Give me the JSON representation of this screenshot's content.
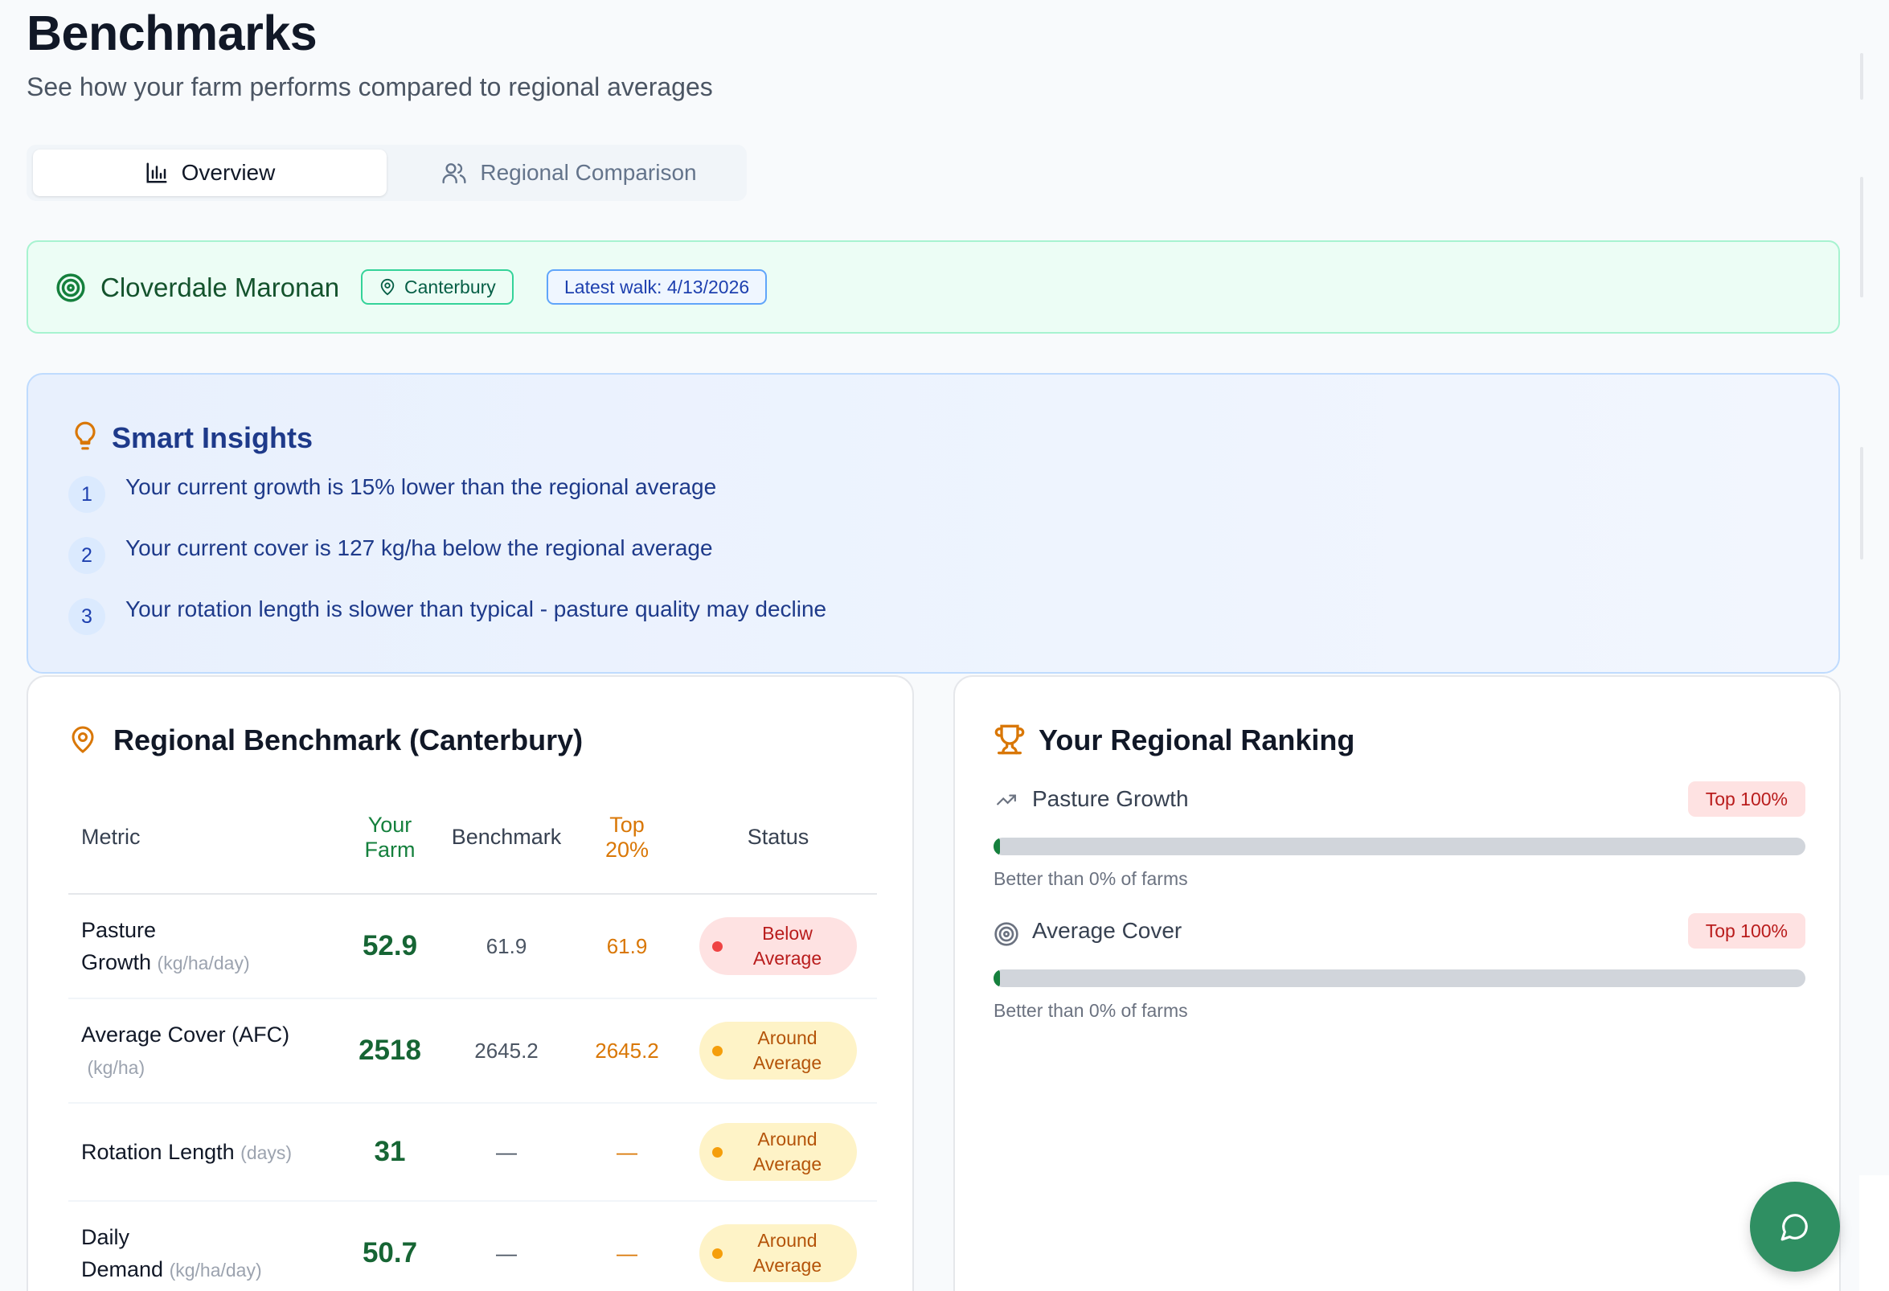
{
  "header": {
    "title": "Benchmarks",
    "subtitle": "See how your farm performs compared to regional averages"
  },
  "tabs": [
    {
      "label": "Overview",
      "icon": "bar-chart-icon",
      "active": true
    },
    {
      "label": "Regional Comparison",
      "icon": "users-icon",
      "active": false
    }
  ],
  "farm": {
    "name": "Cloverdale Maronan",
    "region": "Canterbury",
    "latest_walk": "Latest walk: 4/13/2026"
  },
  "insights": {
    "title": "Smart Insights",
    "items": [
      {
        "num": "1",
        "text": "Your current growth is 15% lower than the regional average"
      },
      {
        "num": "2",
        "text": "Your current cover is 127 kg/ha below the regional average"
      },
      {
        "num": "3",
        "text": "Your rotation length is slower than typical - pasture quality may decline"
      }
    ]
  },
  "benchmark": {
    "title": "Regional Benchmark (Canterbury)",
    "columns": {
      "metric": "Metric",
      "farm_line1": "Your",
      "farm_line2": "Farm",
      "benchmark": "Benchmark",
      "top_line1": "Top",
      "top_line2": "20%",
      "status": "Status"
    },
    "rows": [
      {
        "metric_line1": "Pasture",
        "metric_line2": "Growth",
        "unit": "(kg/ha/day)",
        "farm": "52.9",
        "benchmark": "61.9",
        "top": "61.9",
        "status_line1": "Below",
        "status_line2": "Average",
        "status_type": "below"
      },
      {
        "metric_line1": "Average Cover (AFC)",
        "metric_line2": "",
        "unit": "(kg/ha)",
        "farm": "2518",
        "benchmark": "2645.2",
        "top": "2645.2",
        "status_line1": "Around",
        "status_line2": "Average",
        "status_type": "around"
      },
      {
        "metric_line1": "Rotation Length",
        "metric_line2": "",
        "unit": "(days)",
        "farm": "31",
        "benchmark": "—",
        "top": "—",
        "status_line1": "Around",
        "status_line2": "Average",
        "status_type": "around"
      },
      {
        "metric_line1": "Daily",
        "metric_line2": "Demand",
        "unit": "(kg/ha/day)",
        "farm": "50.7",
        "benchmark": "—",
        "top": "—",
        "status_line1": "Around",
        "status_line2": "Average",
        "status_type": "around"
      }
    ]
  },
  "ranking": {
    "title": "Your Regional Ranking",
    "items": [
      {
        "label": "Pasture Growth",
        "icon": "trending-up-icon",
        "badge": "Top 100%",
        "percentile": 0,
        "note": "Better than 0% of farms"
      },
      {
        "label": "Average Cover",
        "icon": "target-icon",
        "badge": "Top 100%",
        "percentile": 0,
        "note": "Better than 0% of farms"
      }
    ]
  },
  "colors": {
    "brand_green": "#2f8f62",
    "below": "#ef4444",
    "around": "#f59e0b",
    "insight_blue": "#1e3a8a"
  }
}
